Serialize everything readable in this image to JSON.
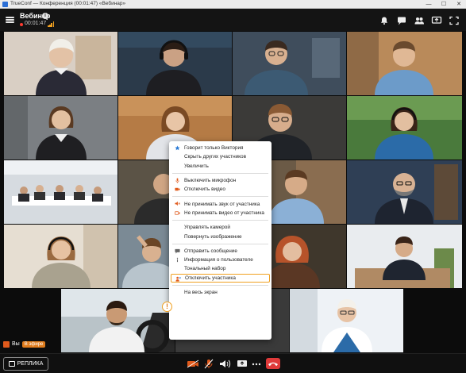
{
  "os_window": {
    "title": "TrueConf — Конференция (00:01:47) «Вебинар»",
    "minimize": "—",
    "maximize": "☐",
    "close": "✕"
  },
  "header": {
    "title": "Вебинар",
    "info_icon": "info-icon",
    "timer": "00:01:47",
    "icons": [
      "bell-icon",
      "chat-icon",
      "participants-icon",
      "share-screen-icon",
      "fullscreen-icon"
    ]
  },
  "self_view": {
    "you_label": "Вы",
    "live_badge": "В эфире"
  },
  "bottom_bar": {
    "reply_label": "РЕПЛИКА",
    "controls": [
      "camera-icon",
      "microphone-icon",
      "speaker-icon",
      "share-icon",
      "more-icon",
      "hangup-icon"
    ],
    "hangup_color": "#e03a3a"
  },
  "context_menu": {
    "items": [
      {
        "label": "Говорит только Виктория",
        "icon": "star-icon"
      },
      {
        "label": "Скрыть других участников",
        "icon": ""
      },
      {
        "label": "Увеличить",
        "icon": ""
      },
      {
        "sep": true
      },
      {
        "label": "Выключить микрофон",
        "icon": "microphone-icon"
      },
      {
        "label": "Отключить видео",
        "icon": "camera-icon"
      },
      {
        "sep": true
      },
      {
        "label": "Не принимать звук от участника",
        "icon": "speaker-off-icon"
      },
      {
        "label": "Не принимать видео от участника",
        "icon": "video-off-icon"
      },
      {
        "sep": true
      },
      {
        "label": "Управлять камерой",
        "icon": ""
      },
      {
        "label": "Повернуть изображение",
        "icon": ""
      },
      {
        "sep": true
      },
      {
        "label": "Отправить сообщение",
        "icon": "message-icon"
      },
      {
        "label": "Информация о пользователе",
        "icon": "info-icon"
      },
      {
        "label": "Тональный набор",
        "icon": ""
      },
      {
        "label": "Отключить участника",
        "icon": "kick-user-icon",
        "active": true
      },
      {
        "sep": true
      },
      {
        "label": "На весь экран",
        "icon": ""
      }
    ]
  },
  "colors": {
    "accent": "#f0a020",
    "menu_icon_orange": "#e05a1c",
    "menu_icon_blue": "#2b7bd6"
  }
}
